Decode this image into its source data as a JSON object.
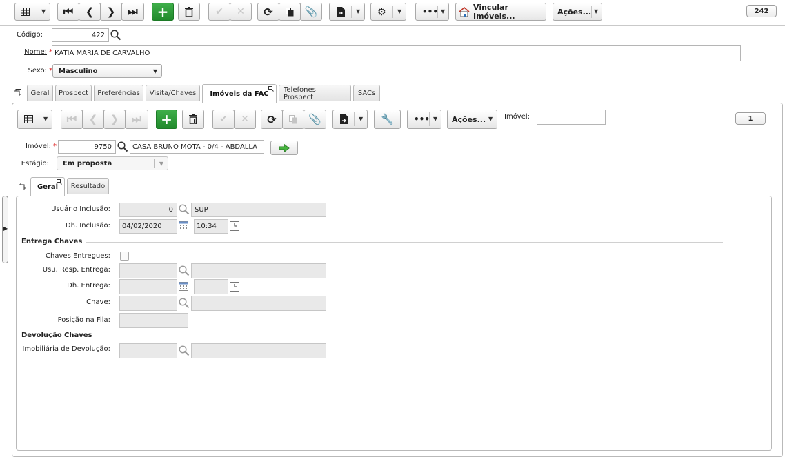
{
  "toolbar": {
    "vincular_label": "Vincular Imóveis...",
    "acoes_label": "Ações...",
    "count_badge": "242"
  },
  "form": {
    "codigo_label": "Código:",
    "codigo_value": "422",
    "nome_label": "Nome:",
    "nome_value": "KATIA MARIA DE CARVALHO",
    "sexo_label": "Sexo:",
    "sexo_value": "Masculino"
  },
  "tabs": [
    {
      "label": "Geral"
    },
    {
      "label": "Prospect"
    },
    {
      "label": "Preferências"
    },
    {
      "label": "Visita/Chaves"
    },
    {
      "label": "Imóveis da FAC"
    },
    {
      "label": "Telefones Prospect"
    },
    {
      "label": "SACs"
    }
  ],
  "sub_toolbar": {
    "acoes_label": "Ações...",
    "imovel_filter_label": "Imóvel:",
    "imovel_filter_value": "",
    "count_badge": "1"
  },
  "detail": {
    "imovel_label": "Imóvel:",
    "imovel_code": "9750",
    "imovel_desc": "CASA BRUNO MOTA - 0/4 - ABDALLA",
    "estagio_label": "Estágio:",
    "estagio_value": "Em proposta"
  },
  "inner_tabs": [
    {
      "label": "Geral"
    },
    {
      "label": "Resultado"
    }
  ],
  "fields": {
    "usuario_inclusao_label": "Usuário Inclusão:",
    "usuario_inclusao_code": "0",
    "usuario_inclusao_name": "SUP",
    "dh_inclusao_label": "Dh. Inclusão:",
    "dh_inclusao_date": "04/02/2020",
    "dh_inclusao_time": "10:34",
    "entrega_section": "Entrega Chaves",
    "chaves_entregues_label": "Chaves Entregues:",
    "usu_resp_label": "Usu. Resp. Entrega:",
    "dh_entrega_label": "Dh. Entrega:",
    "chave_label": "Chave:",
    "posicao_label": "Posição na Fila:",
    "devolucao_section": "Devolução Chaves",
    "imobiliaria_label": "Imobiliária de Devolução:"
  },
  "colors": {
    "accent_green": "#2a9a35",
    "required": "#d22222",
    "border": "#b9b9b9",
    "readonly_bg": "#e9e9e9"
  }
}
